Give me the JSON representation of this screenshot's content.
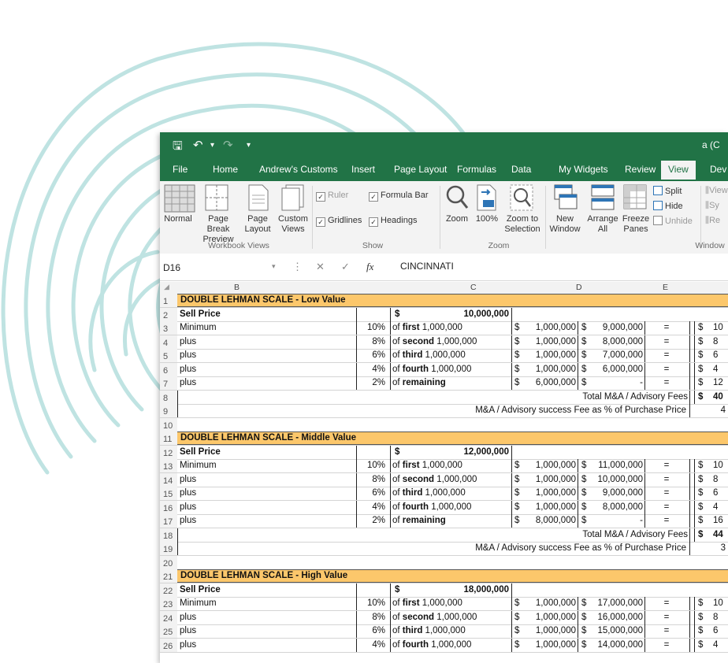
{
  "colors": {
    "accent": "#217346",
    "band": "#fcc76b",
    "swirl": "#bfe3e2"
  },
  "quick_access": {
    "save_icon": "save-icon",
    "undo_icon": "undo-icon",
    "redo_icon": "redo-icon",
    "more_icon": "customize-icon"
  },
  "title": "a (C",
  "tabs": [
    "File",
    "Home",
    "Andrew's Customs",
    "Insert",
    "Page Layout",
    "Formulas",
    "Data",
    "My Widgets",
    "Review",
    "View",
    "Dev"
  ],
  "active_tab": "View",
  "ribbon": {
    "workbook_views": {
      "label": "Workbook Views",
      "items": [
        "Normal",
        "Page Break Preview",
        "Page Layout",
        "Custom Views"
      ]
    },
    "show": {
      "label": "Show",
      "ruler": "Ruler",
      "formula_bar": "Formula Bar",
      "gridlines": "Gridlines",
      "headings": "Headings"
    },
    "zoom": {
      "label": "Zoom",
      "items": [
        "Zoom",
        "100%",
        "Zoom to Selection"
      ]
    },
    "window": {
      "label": "Window",
      "items": [
        "New Window",
        "Arrange All",
        "Freeze Panes"
      ],
      "split": "Split",
      "hide": "Hide",
      "unhide": "Unhide",
      "side": [
        "View",
        "Sy",
        "Re"
      ]
    }
  },
  "formula_bar": {
    "name_box": "D16",
    "fx": "fx",
    "content": "CINCINNATI"
  },
  "columns": [
    "B",
    "C",
    "D",
    "E"
  ],
  "rows": [
    {
      "n": "1",
      "type": "band",
      "text": "DOUBLE LEHMAN SCALE  - Low Value"
    },
    {
      "n": "2",
      "type": "sell",
      "label": "Sell Price",
      "dollar": "$",
      "value": "10,000,000"
    },
    {
      "n": "3",
      "type": "tier",
      "label": "Minimum",
      "pct": "10%",
      "of": "of",
      "which": "first",
      "amt": "1,000,000",
      "d1": "$",
      "v1": "1,000,000",
      "d2": "$",
      "v2": "9,000,000",
      "eq": "=",
      "d3": "$",
      "v3": "10"
    },
    {
      "n": "4",
      "type": "tier",
      "label": "plus",
      "pct": "8%",
      "of": "of",
      "which": "second",
      "amt": "1,000,000",
      "d1": "$",
      "v1": "1,000,000",
      "d2": "$",
      "v2": "8,000,000",
      "eq": "=",
      "d3": "$",
      "v3": "8"
    },
    {
      "n": "5",
      "type": "tier",
      "label": "plus",
      "pct": "6%",
      "of": "of",
      "which": "third",
      "amt": "1,000,000",
      "d1": "$",
      "v1": "1,000,000",
      "d2": "$",
      "v2": "7,000,000",
      "eq": "=",
      "d3": "$",
      "v3": "6"
    },
    {
      "n": "6",
      "type": "tier",
      "label": "plus",
      "pct": "4%",
      "of": "of",
      "which": "fourth",
      "amt": "1,000,000",
      "d1": "$",
      "v1": "1,000,000",
      "d2": "$",
      "v2": "6,000,000",
      "eq": "=",
      "d3": "$",
      "v3": "4"
    },
    {
      "n": "7",
      "type": "tier",
      "label": "plus",
      "pct": "2%",
      "of": "of",
      "which": "remaining",
      "amt": "",
      "d1": "$",
      "v1": "6,000,000",
      "d2": "$",
      "v2": "-",
      "eq": "=",
      "d3": "$",
      "v3": "12"
    },
    {
      "n": "8",
      "type": "total",
      "text": "Total M&A / Advisory Fees",
      "d3": "$",
      "v3": "40"
    },
    {
      "n": "9",
      "type": "pct",
      "text": "M&A / Advisory success Fee as % of Purchase Price",
      "v3": "4"
    },
    {
      "n": "10",
      "type": "blank"
    },
    {
      "n": "11",
      "type": "band",
      "text": "DOUBLE LEHMAN SCALE - Middle Value"
    },
    {
      "n": "12",
      "type": "sell",
      "label": "Sell Price",
      "dollar": "$",
      "value": "12,000,000"
    },
    {
      "n": "13",
      "type": "tier",
      "label": "Minimum",
      "pct": "10%",
      "of": "of",
      "which": "first",
      "amt": "1,000,000",
      "d1": "$",
      "v1": "1,000,000",
      "d2": "$",
      "v2": "11,000,000",
      "eq": "=",
      "d3": "$",
      "v3": "10"
    },
    {
      "n": "14",
      "type": "tier",
      "label": "plus",
      "pct": "8%",
      "of": "of",
      "which": "second",
      "amt": "1,000,000",
      "d1": "$",
      "v1": "1,000,000",
      "d2": "$",
      "v2": "10,000,000",
      "eq": "=",
      "d3": "$",
      "v3": "8"
    },
    {
      "n": "15",
      "type": "tier",
      "label": "plus",
      "pct": "6%",
      "of": "of",
      "which": "third",
      "amt": "1,000,000",
      "d1": "$",
      "v1": "1,000,000",
      "d2": "$",
      "v2": "9,000,000",
      "eq": "=",
      "d3": "$",
      "v3": "6"
    },
    {
      "n": "16",
      "type": "tier",
      "label": "plus",
      "pct": "4%",
      "of": "of",
      "which": "fourth",
      "amt": "1,000,000",
      "d1": "$",
      "v1": "1,000,000",
      "d2": "$",
      "v2": "8,000,000",
      "eq": "=",
      "d3": "$",
      "v3": "4"
    },
    {
      "n": "17",
      "type": "tier",
      "label": "plus",
      "pct": "2%",
      "of": "of",
      "which": "remaining",
      "amt": "",
      "d1": "$",
      "v1": "8,000,000",
      "d2": "$",
      "v2": "-",
      "eq": "=",
      "d3": "$",
      "v3": "16"
    },
    {
      "n": "18",
      "type": "total",
      "text": "Total M&A / Advisory Fees",
      "d3": "$",
      "v3": "44"
    },
    {
      "n": "19",
      "type": "pct",
      "text": "M&A / Advisory success Fee as % of Purchase Price",
      "v3": "3"
    },
    {
      "n": "20",
      "type": "blank"
    },
    {
      "n": "21",
      "type": "band",
      "text": "DOUBLE LEHMAN SCALE - High Value"
    },
    {
      "n": "22",
      "type": "sell",
      "label": "Sell Price",
      "dollar": "$",
      "value": "18,000,000"
    },
    {
      "n": "23",
      "type": "tier",
      "label": "Minimum",
      "pct": "10%",
      "of": "of",
      "which": "first",
      "amt": "1,000,000",
      "d1": "$",
      "v1": "1,000,000",
      "d2": "$",
      "v2": "17,000,000",
      "eq": "=",
      "d3": "$",
      "v3": "10"
    },
    {
      "n": "24",
      "type": "tier",
      "label": "plus",
      "pct": "8%",
      "of": "of",
      "which": "second",
      "amt": "1,000,000",
      "d1": "$",
      "v1": "1,000,000",
      "d2": "$",
      "v2": "16,000,000",
      "eq": "=",
      "d3": "$",
      "v3": "8"
    },
    {
      "n": "25",
      "type": "tier",
      "label": "plus",
      "pct": "6%",
      "of": "of",
      "which": "third",
      "amt": "1,000,000",
      "d1": "$",
      "v1": "1,000,000",
      "d2": "$",
      "v2": "15,000,000",
      "eq": "=",
      "d3": "$",
      "v3": "6"
    },
    {
      "n": "26",
      "type": "tier",
      "label": "plus",
      "pct": "4%",
      "of": "of",
      "which": "fourth",
      "amt": "1,000,000",
      "d1": "$",
      "v1": "1,000,000",
      "d2": "$",
      "v2": "14,000,000",
      "eq": "=",
      "d3": "$",
      "v3": "4"
    }
  ]
}
